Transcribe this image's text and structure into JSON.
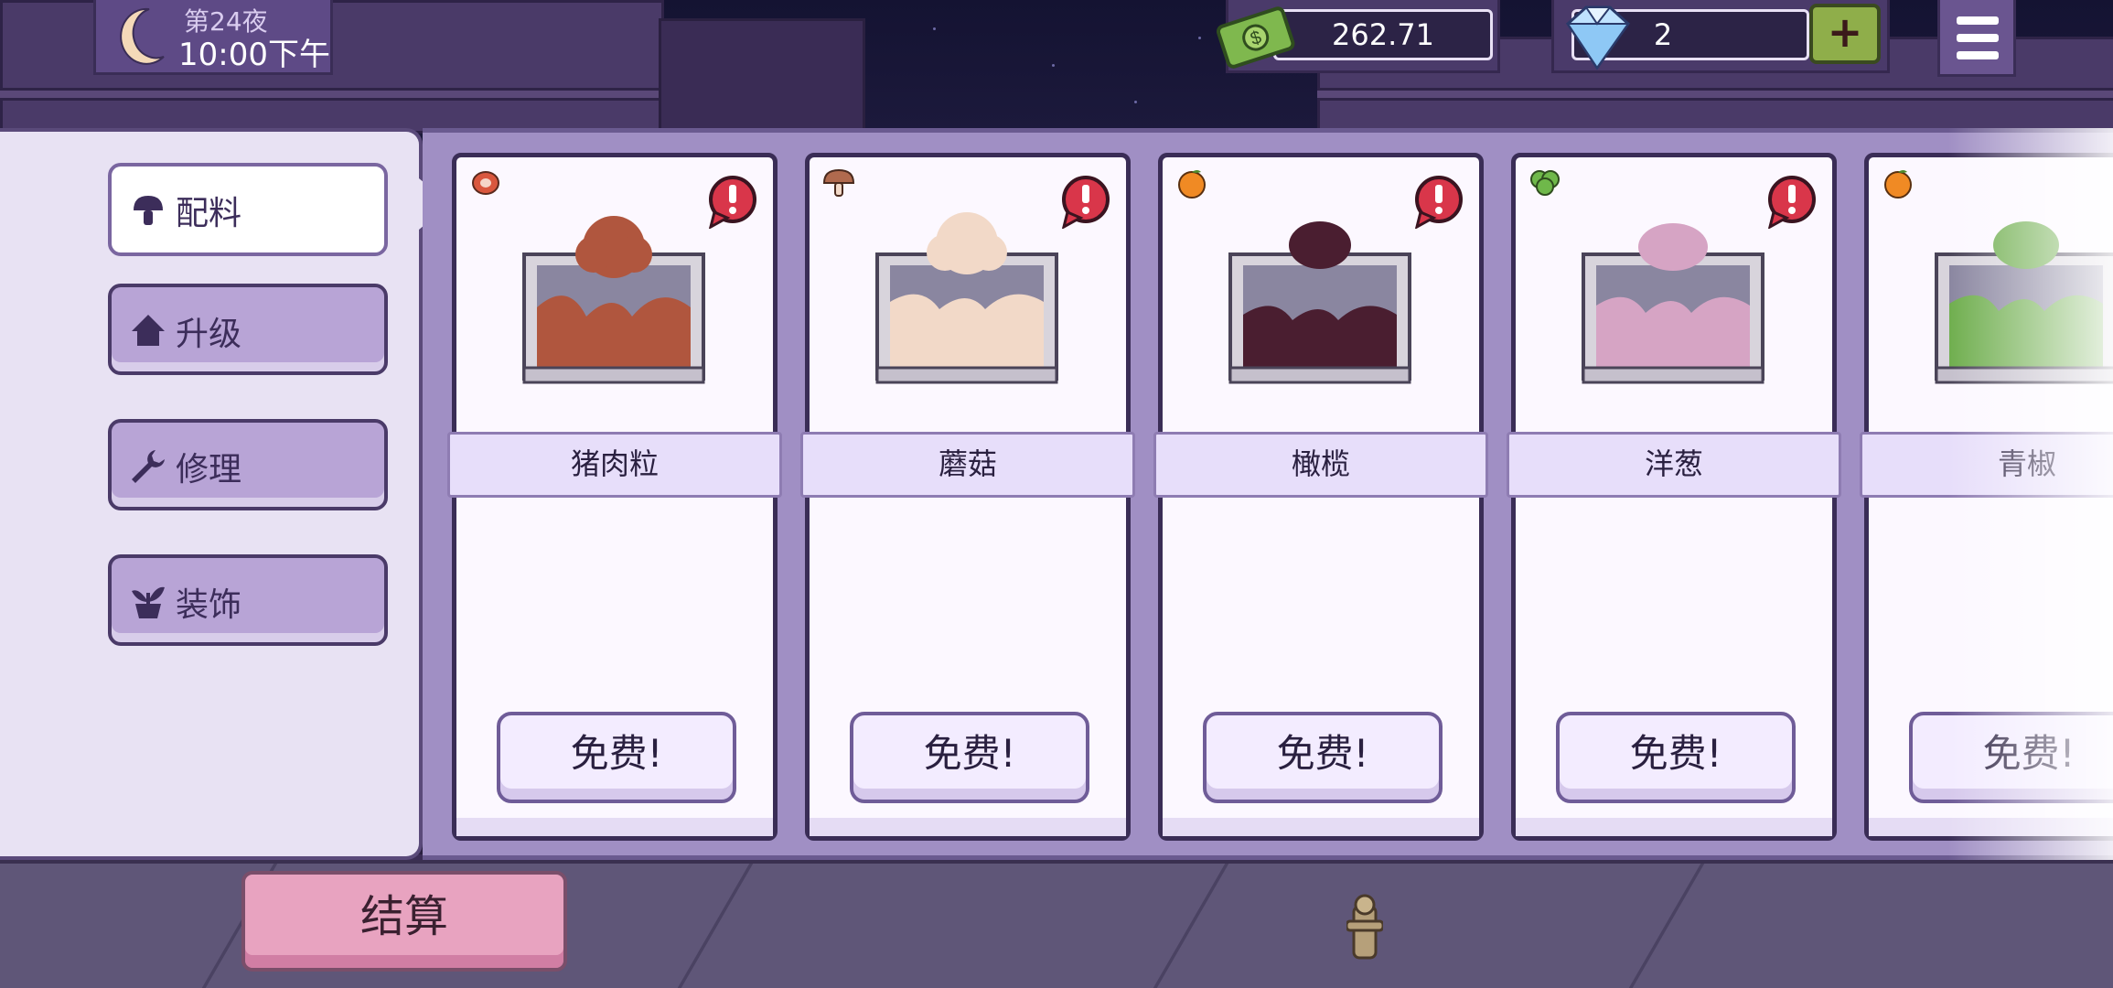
{
  "hud": {
    "night_label": "第24夜",
    "clock": "10:00下午",
    "cash": "262.71",
    "gems": "2",
    "plus_label": "+",
    "moon_icon": "moon-icon",
    "cash_icon": "cash-icon",
    "gem_icon": "diamond-icon",
    "menu_icon": "hamburger-menu-icon"
  },
  "tabs": [
    {
      "label": "配料",
      "icon": "mushroom-icon",
      "active": true
    },
    {
      "label": "升级",
      "icon": "house-icon",
      "active": false
    },
    {
      "label": "修理",
      "icon": "wrench-icon",
      "active": false
    },
    {
      "label": "装饰",
      "icon": "potted-plant-icon",
      "active": false
    }
  ],
  "ingredients": [
    {
      "name": "猪肉粒",
      "button": "免费!",
      "category_icon": "meat-icon",
      "color": "#b0563e",
      "alert": true
    },
    {
      "name": "蘑菇",
      "button": "免费!",
      "category_icon": "mushroom-icon",
      "color": "#f2d9c8",
      "alert": true
    },
    {
      "name": "橄榄",
      "button": "免费!",
      "category_icon": "orange-icon",
      "color": "#4a1e30",
      "alert": true
    },
    {
      "name": "洋葱",
      "button": "免费!",
      "category_icon": "leafy-green-icon",
      "color": "#d6a4c4",
      "alert": true
    },
    {
      "name": "青椒",
      "button": "免费!",
      "category_icon": "orange-icon",
      "color": "#6fae4e",
      "alert": false
    }
  ],
  "checkout_label": "结算",
  "colors": {
    "panel_bg": "#e8e2f3",
    "shelf_bg": "#a08fc4",
    "tab_bg": "#b8a4d6",
    "checkout_bg": "#e8a3c0",
    "plus_bg": "#8fae4a"
  }
}
